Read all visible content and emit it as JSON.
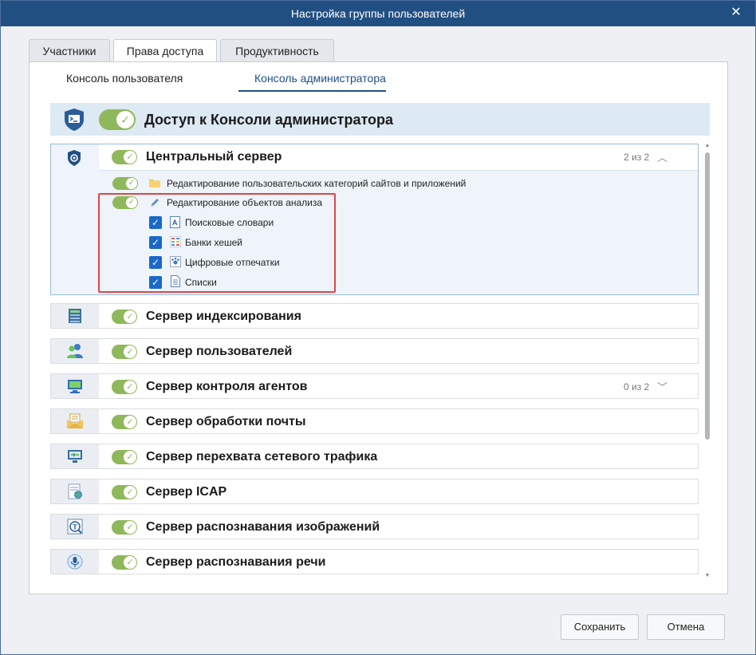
{
  "window": {
    "title": "Настройка группы пользователей",
    "close_symbol": "✕"
  },
  "tabs": [
    {
      "label": "Участники",
      "active": false
    },
    {
      "label": "Права доступа",
      "active": true
    },
    {
      "label": "Продуктивность",
      "active": false
    }
  ],
  "subtabs": [
    {
      "label": "Консоль пользователя",
      "active": false
    },
    {
      "label": "Консоль администратора",
      "active": true
    }
  ],
  "access": {
    "title": "Доступ к Консоли администратора",
    "enabled": true,
    "icon": "terminal-shield-icon"
  },
  "servers": [
    {
      "name": "Центральный сервер",
      "icon": "central-server-icon",
      "enabled": true,
      "count": "2 из 2",
      "expanded": true,
      "children": [
        {
          "label": "Редактирование пользовательских категорий сайтов и приложений",
          "icon": "folder-icon",
          "enabled": true
        },
        {
          "label": "Редактирование объектов анализа",
          "icon": "pencil-icon",
          "enabled": true,
          "items": [
            {
              "label": "Поисковые словари",
              "icon": "dictionary-icon",
              "checked": true
            },
            {
              "label": "Банки хешей",
              "icon": "hash-bank-icon",
              "checked": true
            },
            {
              "label": "Цифровые отпечатки",
              "icon": "fingerprint-icon",
              "checked": true
            },
            {
              "label": "Списки",
              "icon": "list-doc-icon",
              "checked": true
            }
          ]
        }
      ]
    },
    {
      "name": "Сервер индексирования",
      "icon": "index-server-icon",
      "enabled": true
    },
    {
      "name": "Сервер пользователей",
      "icon": "users-server-icon",
      "enabled": true
    },
    {
      "name": "Сервер контроля агентов",
      "icon": "agents-server-icon",
      "enabled": true,
      "count": "0 из 2",
      "expanded": false
    },
    {
      "name": "Сервер обработки почты",
      "icon": "mail-server-icon",
      "enabled": true
    },
    {
      "name": "Сервер перехвата сетевого трафика",
      "icon": "traffic-server-icon",
      "enabled": true
    },
    {
      "name": "Сервер ICAP",
      "icon": "icap-server-icon",
      "enabled": true
    },
    {
      "name": "Сервер распознавания изображений",
      "icon": "image-recognition-icon",
      "enabled": true
    },
    {
      "name": "Сервер распознавания речи",
      "icon": "speech-recognition-icon",
      "enabled": true
    }
  ],
  "buttons": {
    "save": "Сохранить",
    "cancel": "Отмена"
  },
  "colors": {
    "titlebar": "#214f82",
    "toggle_on": "#8fb85a",
    "checkbox": "#1a68c8",
    "highlight": "#e04545",
    "accent": "#1e4f86"
  }
}
